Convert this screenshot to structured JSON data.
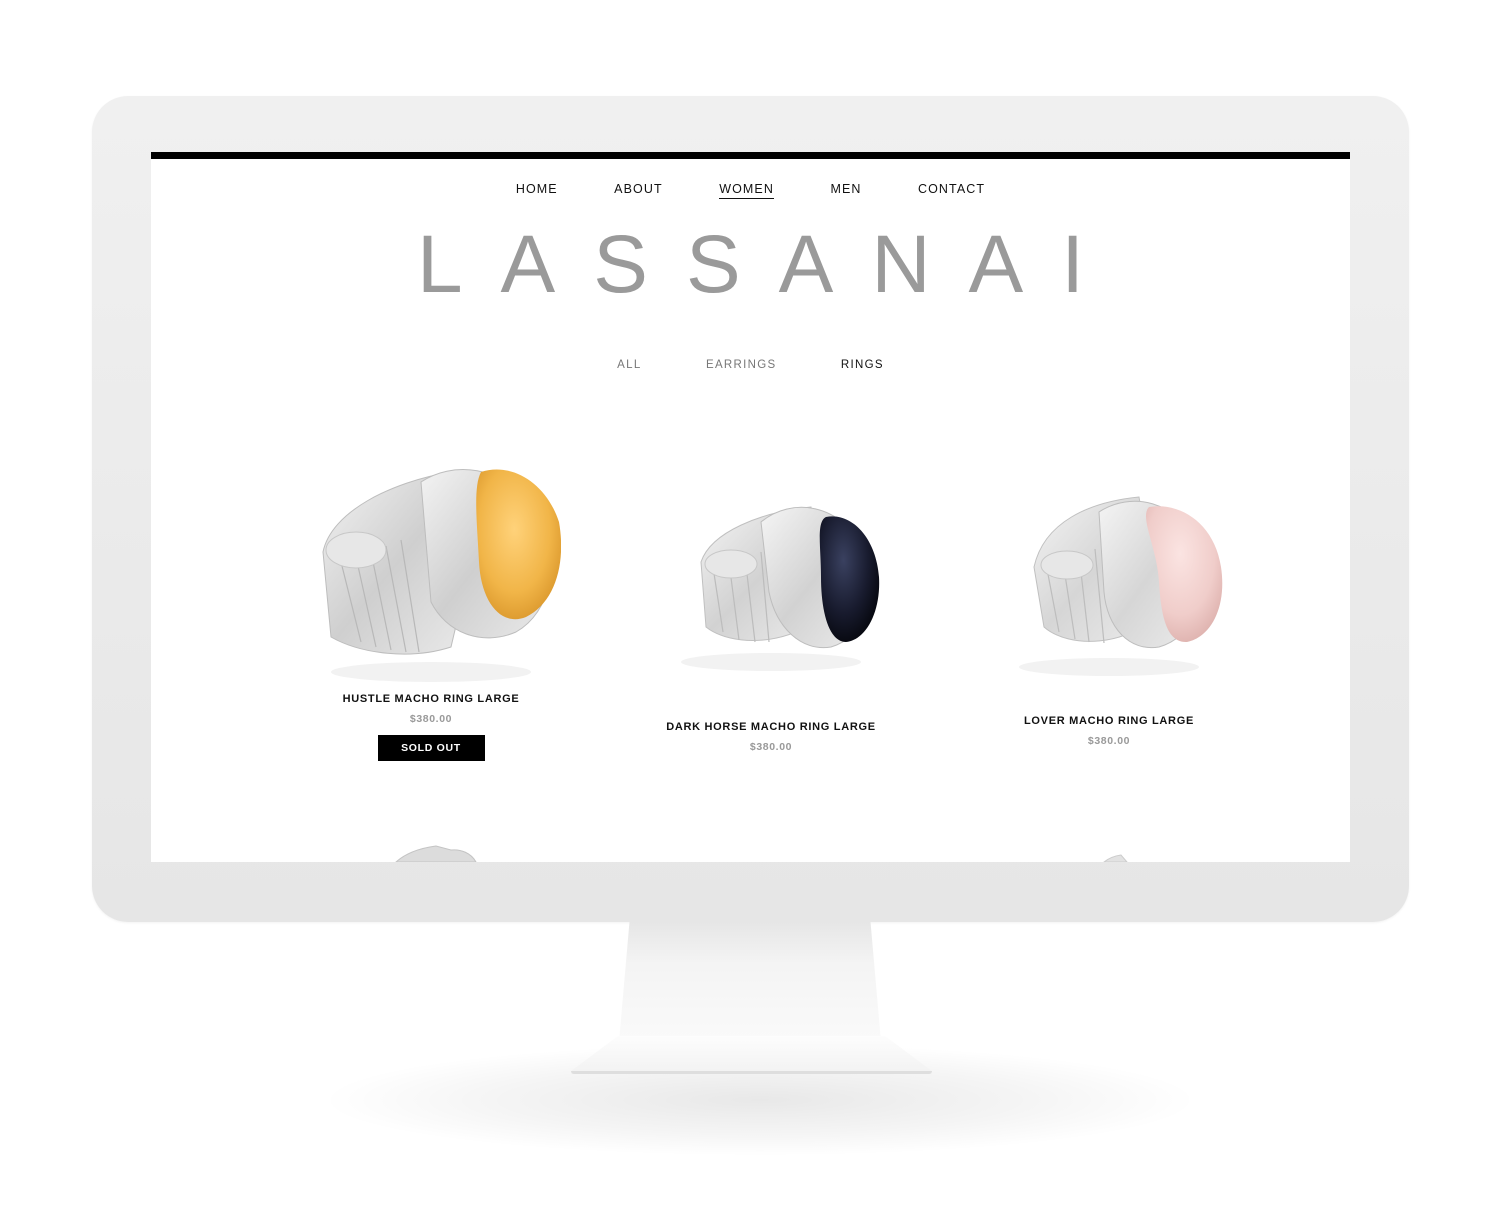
{
  "nav": {
    "items": [
      {
        "label": "HOME",
        "active": false
      },
      {
        "label": "ABOUT",
        "active": false
      },
      {
        "label": "WOMEN",
        "active": true
      },
      {
        "label": "MEN",
        "active": false
      },
      {
        "label": "CONTACT",
        "active": false
      }
    ]
  },
  "brand": {
    "logo_text": "LASSANAI"
  },
  "category_nav": {
    "items": [
      {
        "label": "ALL",
        "current": false
      },
      {
        "label": "EARRINGS",
        "current": false
      },
      {
        "label": "RINGS",
        "current": true
      }
    ]
  },
  "products": [
    {
      "title": "HUSTLE MACHO RING LARGE",
      "price": "$380.00",
      "badge": "SOLD OUT",
      "stone_color": "#f0b648"
    },
    {
      "title": "DARK HORSE MACHO RING LARGE",
      "price": "$380.00",
      "badge": null,
      "stone_color": "#1a1e33"
    },
    {
      "title": "LOVER MACHO RING LARGE",
      "price": "$380.00",
      "badge": null,
      "stone_color": "#f1d1cf"
    }
  ],
  "colors": {
    "accent": "#000000",
    "logo": "#9a9a9a",
    "price": "#999999",
    "silver": "#d9d9d9"
  }
}
